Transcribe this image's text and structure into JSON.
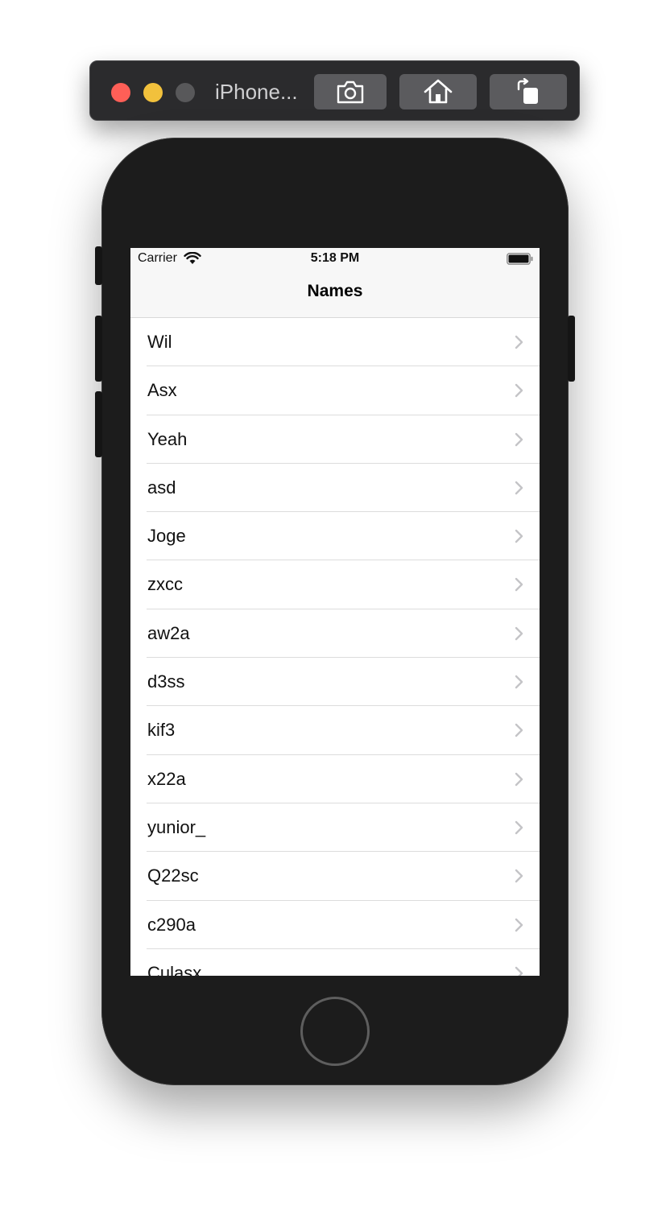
{
  "simulator": {
    "title": "iPhone...",
    "buttons": [
      "screenshot-icon",
      "home-icon",
      "rotate-icon"
    ]
  },
  "status_bar": {
    "carrier": "Carrier",
    "time": "5:18 PM"
  },
  "navbar": {
    "title": "Names"
  },
  "names": [
    "Wil",
    "Asx",
    "Yeah",
    "asd",
    "Joge",
    "zxcc",
    "aw2a",
    "d3ss",
    "kif3",
    "x22a",
    "yunior_",
    "Q22sc",
    "c290a",
    "Culasx"
  ]
}
